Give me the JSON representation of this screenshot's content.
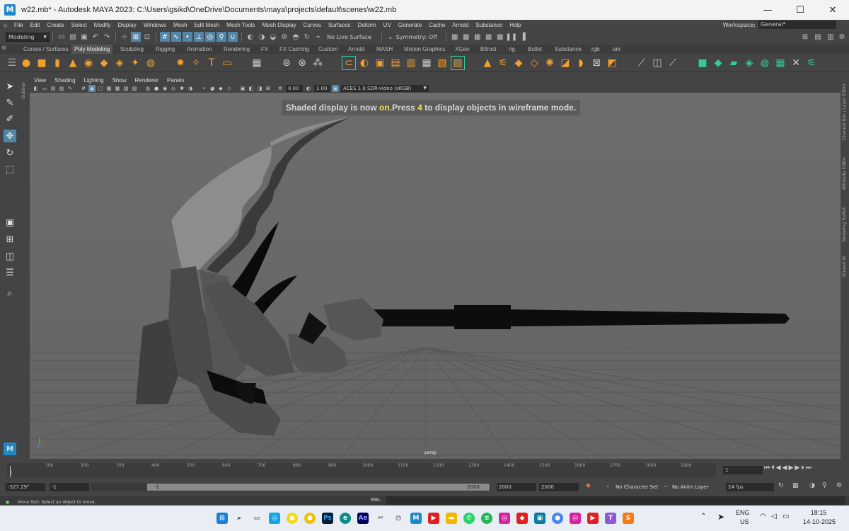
{
  "window": {
    "title": "w22.mb* - Autodesk MAYA 2023: C:\\Users\\gsikd\\OneDrive\\Documents\\maya\\projects\\default\\scenes\\w22.mb",
    "app_icon": "M",
    "minimize": "—",
    "maximize": "☐",
    "close": "✕"
  },
  "menubar": {
    "items": [
      "File",
      "Edit",
      "Create",
      "Select",
      "Modify",
      "Display",
      "Windows",
      "Mesh",
      "Edit Mesh",
      "Mesh Tools",
      "Mesh Display",
      "Curves",
      "Surfaces",
      "Deform",
      "UV",
      "Generate",
      "Cache",
      "Arnold",
      "Substance",
      "Help"
    ],
    "workspace_label": "Workspace:",
    "workspace_value": "General*"
  },
  "statusline": {
    "menuset": "Modeling",
    "live_surface": "No Live Surface",
    "symmetry": "Symmetry: Off"
  },
  "shelf": {
    "tabs": [
      "Curves / Surfaces",
      "Poly Modeling",
      "Sculpting",
      "Rigging",
      "Animation",
      "Rendering",
      "FX",
      "FX Caching",
      "Custom",
      "Arnold",
      "MASH",
      "Motion Graphics",
      "XGen",
      "Bifrost",
      "rig",
      "Bullet",
      "Substance",
      "rgb",
      "ani"
    ],
    "active_tab": "Poly Modeling"
  },
  "panel": {
    "menus": [
      "View",
      "Shading",
      "Lighting",
      "Show",
      "Renderer",
      "Panels"
    ],
    "exposure": "0.00",
    "gamma": "1.00",
    "color_space": "ACES 1.0 SDR-video (sRGB)"
  },
  "viewport": {
    "hud_prefix": "Shaded display is now ",
    "hud_on": "on",
    "hud_mid": ".Press ",
    "hud_key": "4",
    "hud_suffix": " to display objects in wireframe mode.",
    "camera": "persp"
  },
  "side_labels": {
    "outliner": "Outliner",
    "right": [
      "Channel Box / Layer Editor",
      "Attribute Editor",
      "Modeling Toolkit",
      "Human IK"
    ]
  },
  "timeline": {
    "ticks": [
      "1",
      "100",
      "200",
      "300",
      "400",
      "500",
      "600",
      "700",
      "800",
      "900",
      "1000",
      "1100",
      "1200",
      "1300",
      "1400",
      "1500",
      "1600",
      "1700",
      "1800",
      "1900"
    ],
    "current_frame": "1"
  },
  "range": {
    "coord": "-327.29°",
    "start": "-1",
    "slider_start": "-1",
    "slider_end": "2000",
    "end": "2000",
    "end2": "2000",
    "character_set": "No Character Set",
    "anim_layer": "No Anim Layer",
    "fps": "24 fps"
  },
  "command": {
    "mel": "MEL",
    "help": "Move Tool: Select an object to move."
  },
  "taskbar": {
    "lang": "ENG",
    "region": "US",
    "time": "18:15",
    "date": "14-10-2025"
  }
}
